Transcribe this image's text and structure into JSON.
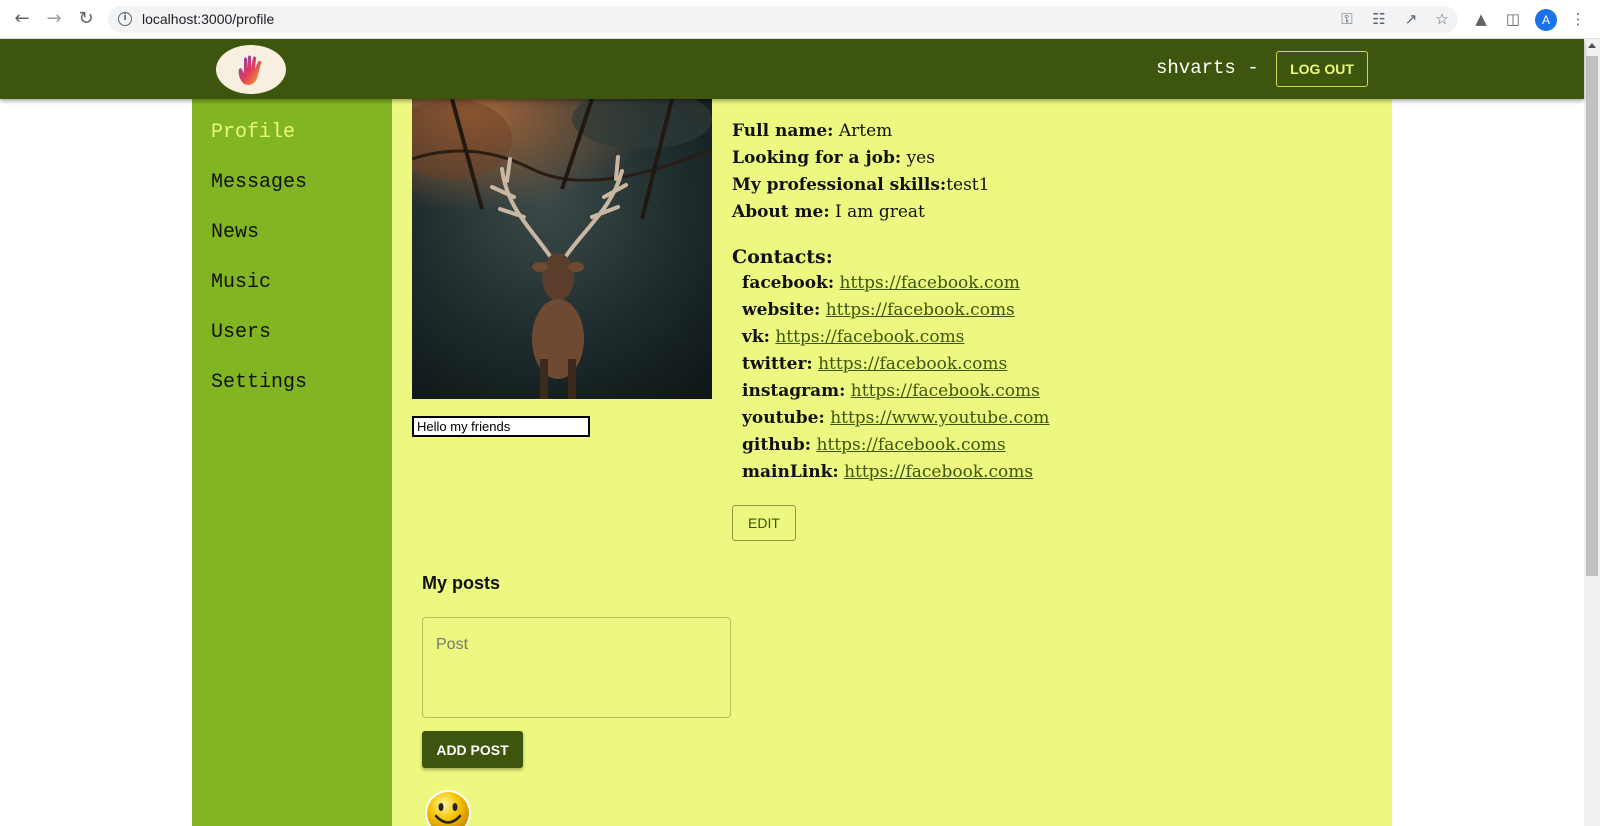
{
  "browser": {
    "url": "localhost:3000/profile",
    "icons": [
      "back-icon",
      "forward-icon",
      "reload-icon",
      "info-icon",
      "key-icon",
      "translate-icon",
      "share-icon",
      "star-icon",
      "extensions-icon",
      "side-panel-icon",
      "profile-icon",
      "menu-icon"
    ],
    "profile_initial": "A"
  },
  "header": {
    "logo_icon": "hand-icon",
    "user_login": "shvarts -",
    "logout_label": "LOG OUT"
  },
  "sidebar": {
    "items": [
      {
        "label": "Profile",
        "active": true
      },
      {
        "label": "Messages",
        "active": false
      },
      {
        "label": "News",
        "active": false
      },
      {
        "label": "Music",
        "active": false
      },
      {
        "label": "Users",
        "active": false
      },
      {
        "label": "Settings",
        "active": false
      }
    ]
  },
  "profile": {
    "status": "Hello my friends",
    "full_name_label": "Full name:",
    "full_name": "Artem",
    "job_label": "Looking for a job:",
    "job": "yes",
    "skills_label": "My professional skills:",
    "skills": "test1",
    "about_label": "About me:",
    "about": "I am great",
    "contacts_title": "Contacts:",
    "contacts": [
      {
        "key": "facebook:",
        "value": "https://facebook.com"
      },
      {
        "key": "website:",
        "value": "https://facebook.coms"
      },
      {
        "key": "vk:",
        "value": "https://facebook.coms"
      },
      {
        "key": "twitter:",
        "value": "https://facebook.coms"
      },
      {
        "key": "instagram:",
        "value": "https://facebook.coms"
      },
      {
        "key": "youtube:",
        "value": "https://www.youtube.com"
      },
      {
        "key": "github:",
        "value": "https://facebook.coms"
      },
      {
        "key": "mainLink:",
        "value": "https://facebook.coms"
      }
    ],
    "edit_label": "EDIT"
  },
  "posts": {
    "title": "My posts",
    "placeholder": "Post",
    "add_label": "ADD POST",
    "avatar_icon": "smiley-icon"
  },
  "colors": {
    "header_bg": "#3d550c",
    "sidebar_bg": "#81b622",
    "content_bg": "#ecf87f",
    "active_nav": "#ecf87f"
  }
}
